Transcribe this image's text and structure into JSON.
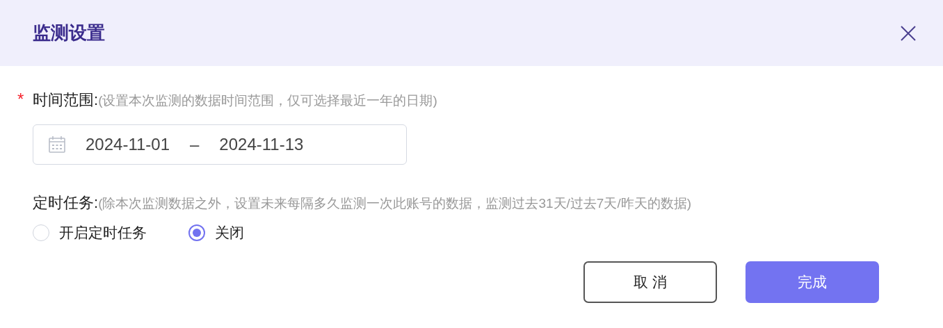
{
  "dialog": {
    "title": "监测设置"
  },
  "time_range": {
    "required_mark": "*",
    "label": "时间范围:",
    "hint": "(设置本次监测的数据时间范围，仅可选择最近一年的日期)",
    "start": "2024-11-01",
    "separator": "–",
    "end": "2024-11-13"
  },
  "schedule": {
    "label": "定时任务:",
    "hint": "(除本次监测数据之外，设置未来每隔多久监测一次此账号的数据，监测过去31天/过去7天/昨天的数据)",
    "options": [
      {
        "label": "开启定时任务",
        "selected": false
      },
      {
        "label": "关闭",
        "selected": true
      }
    ]
  },
  "buttons": [
    {
      "label": "取 消",
      "kind": "secondary"
    },
    {
      "label": "完成",
      "kind": "primary"
    }
  ]
}
